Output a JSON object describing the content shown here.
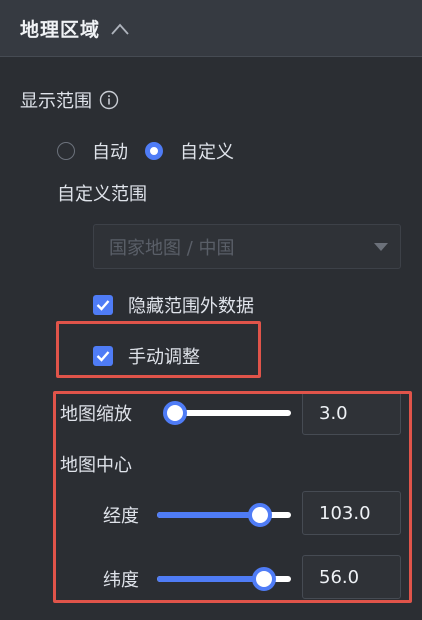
{
  "section": {
    "title": "地理区域"
  },
  "display_range": {
    "label": "显示范围",
    "options": [
      {
        "label": "自动",
        "checked": false
      },
      {
        "label": "自定义",
        "checked": true
      }
    ],
    "custom_range_label": "自定义范围",
    "custom_range_select": {
      "value": "国家地图 / 中国",
      "disabled": true
    }
  },
  "checkboxes": {
    "hide_outside": {
      "label": "隐藏范围外数据",
      "checked": true
    },
    "manual_adjust": {
      "label": "手动调整",
      "checked": true
    }
  },
  "map_zoom": {
    "label": "地图缩放",
    "value": "3.0",
    "slider_fraction": 0.0
  },
  "map_center": {
    "label": "地图中心",
    "longitude": {
      "label": "经度",
      "value": "103.0",
      "slider_fraction": 0.77
    },
    "latitude": {
      "label": "纬度",
      "value": "56.0",
      "slider_fraction": 0.8
    }
  },
  "colors": {
    "accent": "#4f7cf6",
    "highlight": "#e0544a",
    "background": "#2b2e33"
  },
  "icons": {
    "collapse": "chevron-up-icon",
    "info": "info-icon",
    "check": "check-icon",
    "dropdown": "caret-down-icon"
  }
}
